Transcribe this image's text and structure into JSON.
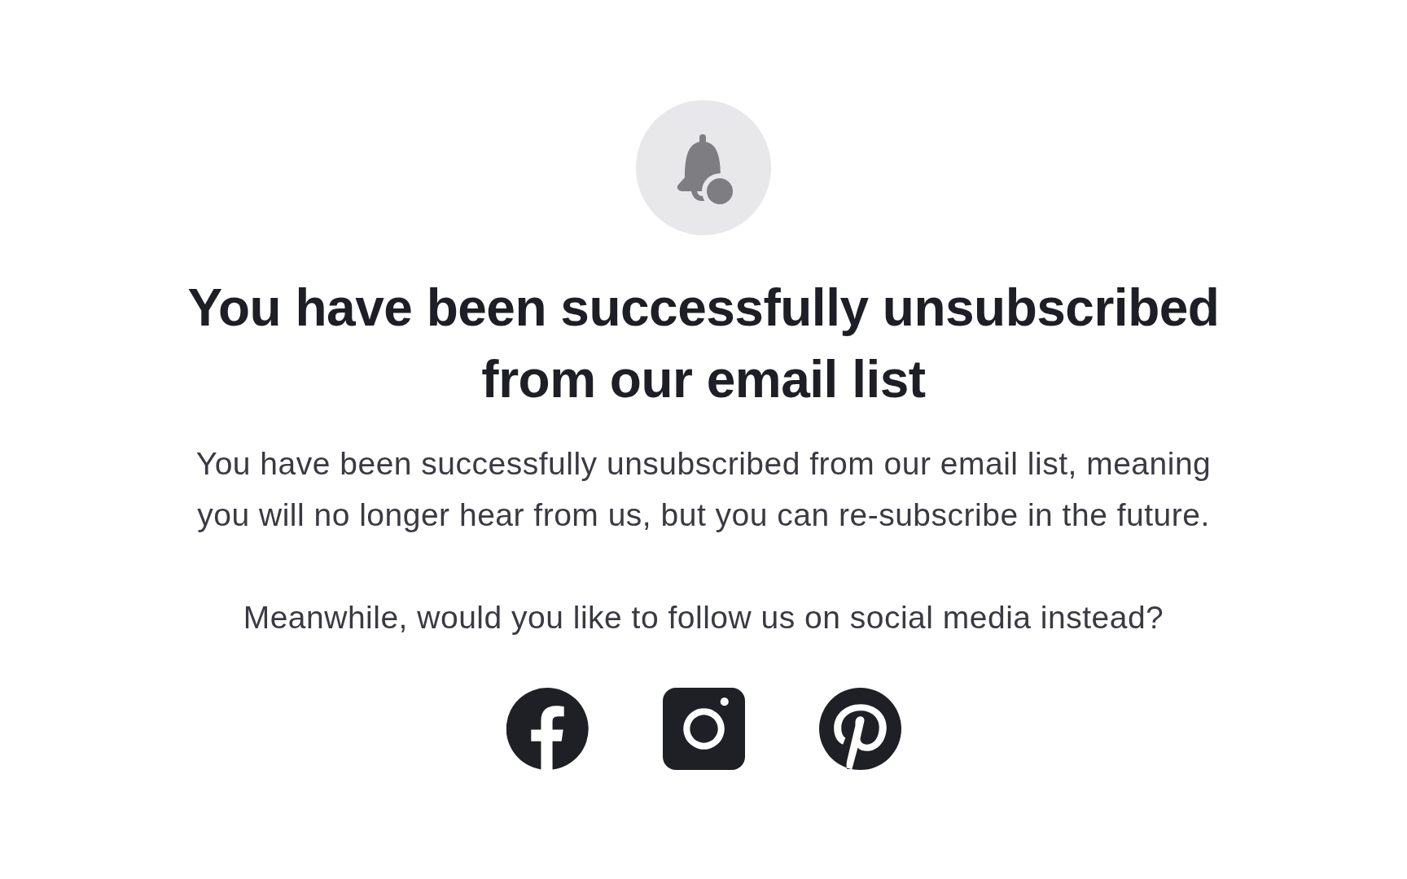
{
  "heading": "You have been successfully unsubscribed from our email list",
  "message": "You have been successfully unsubscribed from our email list, meaning you will no longer hear from us, but you can re-subscribe in the future.",
  "prompt": "Meanwhile, would you like to follow us on social media instead?",
  "social_links": [
    {
      "kind": "facebook"
    },
    {
      "kind": "instagram"
    },
    {
      "kind": "pinterest"
    }
  ]
}
